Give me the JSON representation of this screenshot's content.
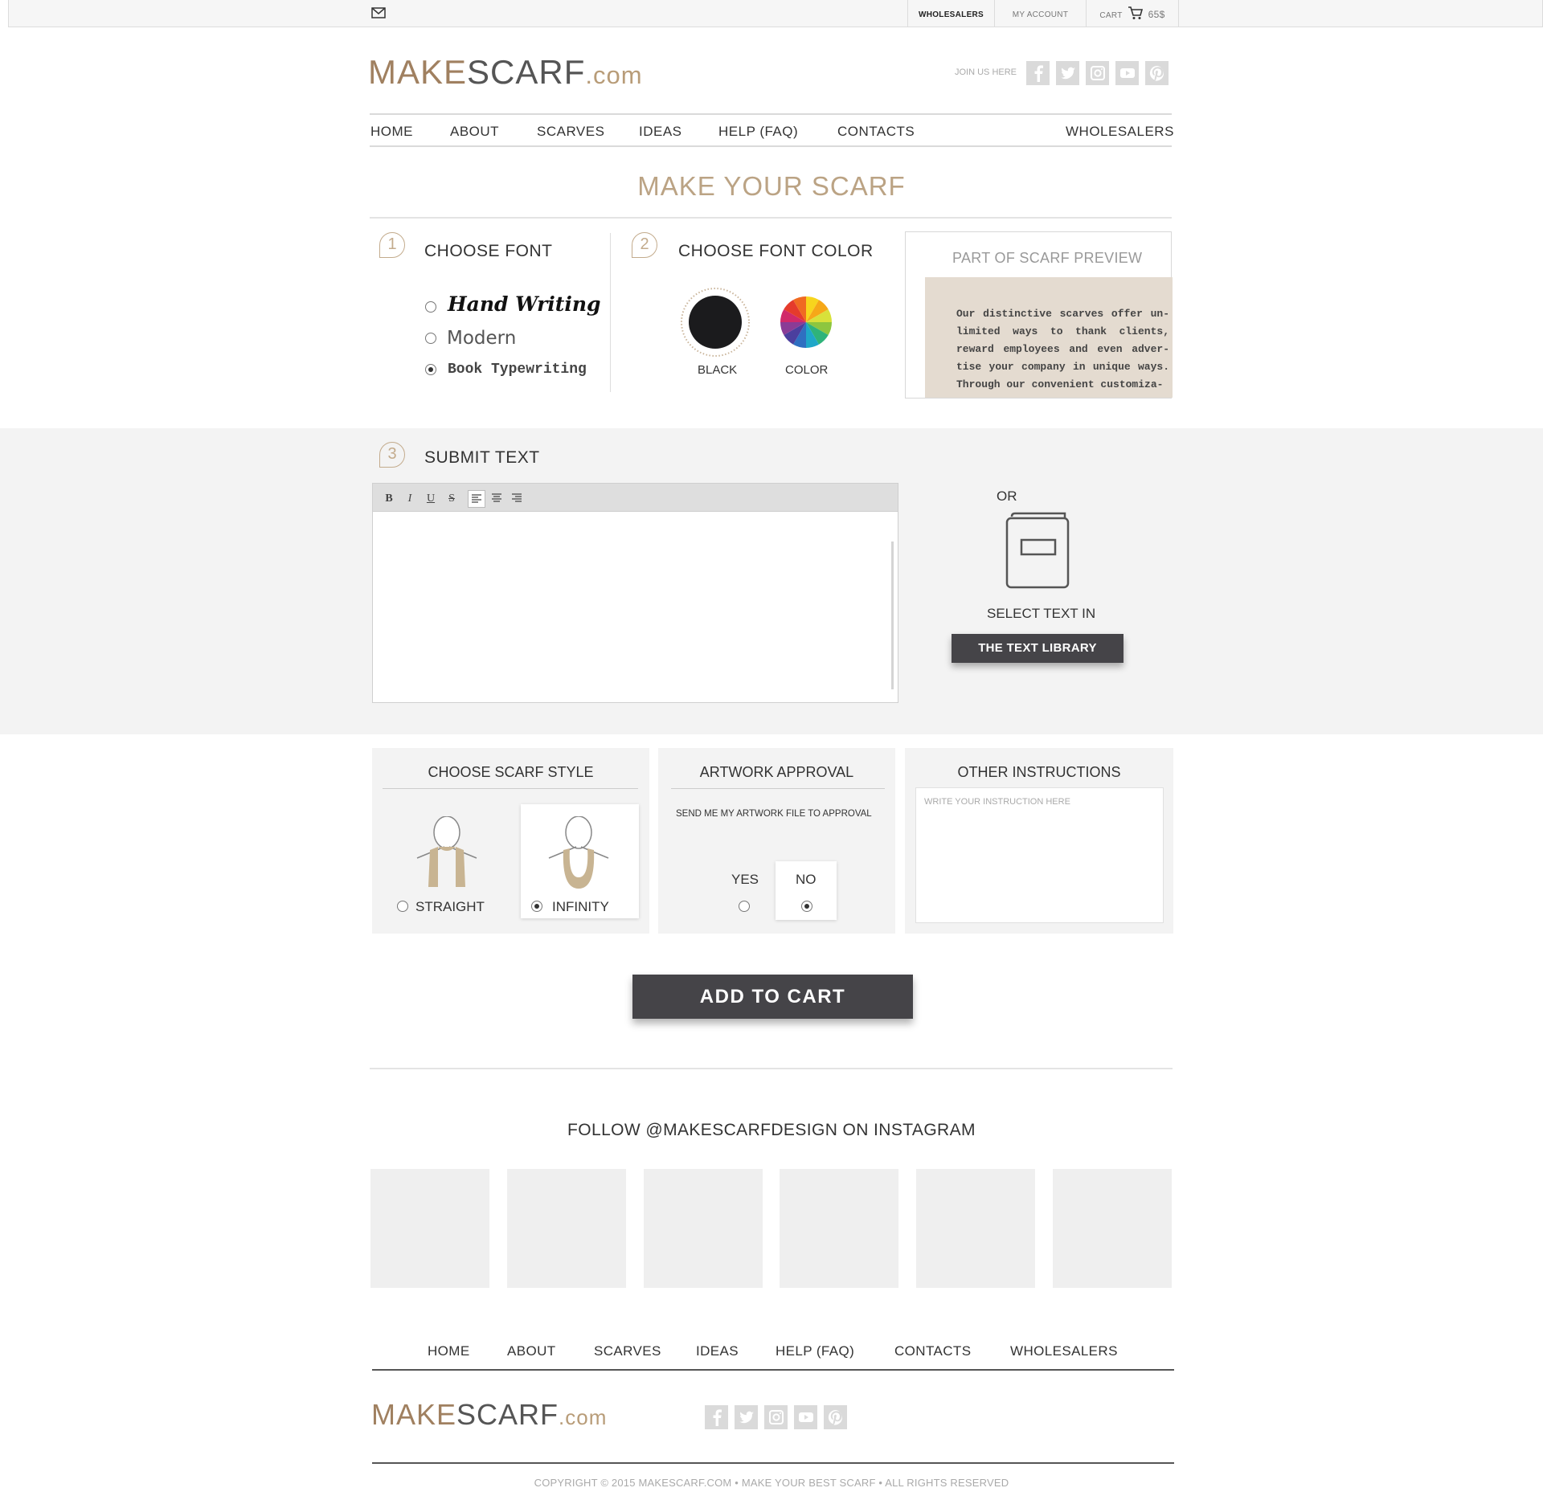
{
  "topbar": {
    "wholesalers": "WHOLESALERS",
    "my_account": "MY ACCOUNT",
    "cart": "CART",
    "cart_total": "65$"
  },
  "header": {
    "logo_part1": "MAKE",
    "logo_part2": "SCARF",
    "logo_part3": ".com",
    "join_us": "JOIN US HERE",
    "social_icons": [
      "facebook-icon",
      "twitter-icon",
      "instagram-icon",
      "youtube-icon",
      "pinterest-icon"
    ]
  },
  "nav": {
    "items": [
      "HOME",
      "ABOUT",
      "SCARVES",
      "IDEAS",
      "HELP (FAQ)",
      "CONTACTS"
    ],
    "wholesalers": "WHOLESALERS"
  },
  "page_title": "MAKE YOUR SCARF",
  "step1": {
    "number": "1",
    "heading": "CHOOSE FONT",
    "options": [
      "Hand Writing",
      "Modern",
      "Book Typewriting"
    ],
    "selected": "Book Typewriting"
  },
  "step2": {
    "number": "2",
    "heading": "CHOOSE FONT COLOR",
    "black_label": "BLACK",
    "color_label": "COLOR"
  },
  "preview": {
    "title": "PART OF SCARF PREVIEW",
    "text": "Our distinctive scarves offer un-limited ways to thank clients, reward employees and even adver-tise your company in unique ways. Through our convenient customiza-"
  },
  "step3": {
    "number": "3",
    "heading": "SUBMIT TEXT",
    "toolbar": [
      "B",
      "I",
      "U",
      "S"
    ],
    "or": "OR",
    "select_text_in": "SELECT TEXT IN",
    "library_button": "THE TEXT LIBRARY"
  },
  "scarf_style": {
    "heading": "CHOOSE SCARF STYLE",
    "straight": "STRAIGHT",
    "infinity": "INFINITY",
    "selected": "INFINITY"
  },
  "artwork": {
    "heading": "ARTWORK APPROVAL",
    "text": "SEND ME MY ARTWORK FILE TO APPROVAL",
    "yes": "YES",
    "no": "NO",
    "selected": "NO"
  },
  "instructions": {
    "heading": "OTHER INSTRUCTIONS",
    "placeholder": "WRITE YOUR INSTRUCTION HERE"
  },
  "add_to_cart": "ADD TO CART",
  "instagram": {
    "heading": "FOLLOW @MAKESCARFDESIGN ON INSTAGRAM"
  },
  "footer": {
    "nav": [
      "HOME",
      "ABOUT",
      "SCARVES",
      "IDEAS",
      "HELP (FAQ)",
      "CONTACTS",
      "WHOLESALERS"
    ],
    "copyright": "COPYRIGHT © 2015 MAKESCARF.COM • MAKE YOUR BEST SCARF • ALL RIGHTS RESERVED"
  },
  "colors": {
    "brand_tan": "#bba384",
    "dark_button": "#454448",
    "panel_gray": "#f3f3f3"
  }
}
